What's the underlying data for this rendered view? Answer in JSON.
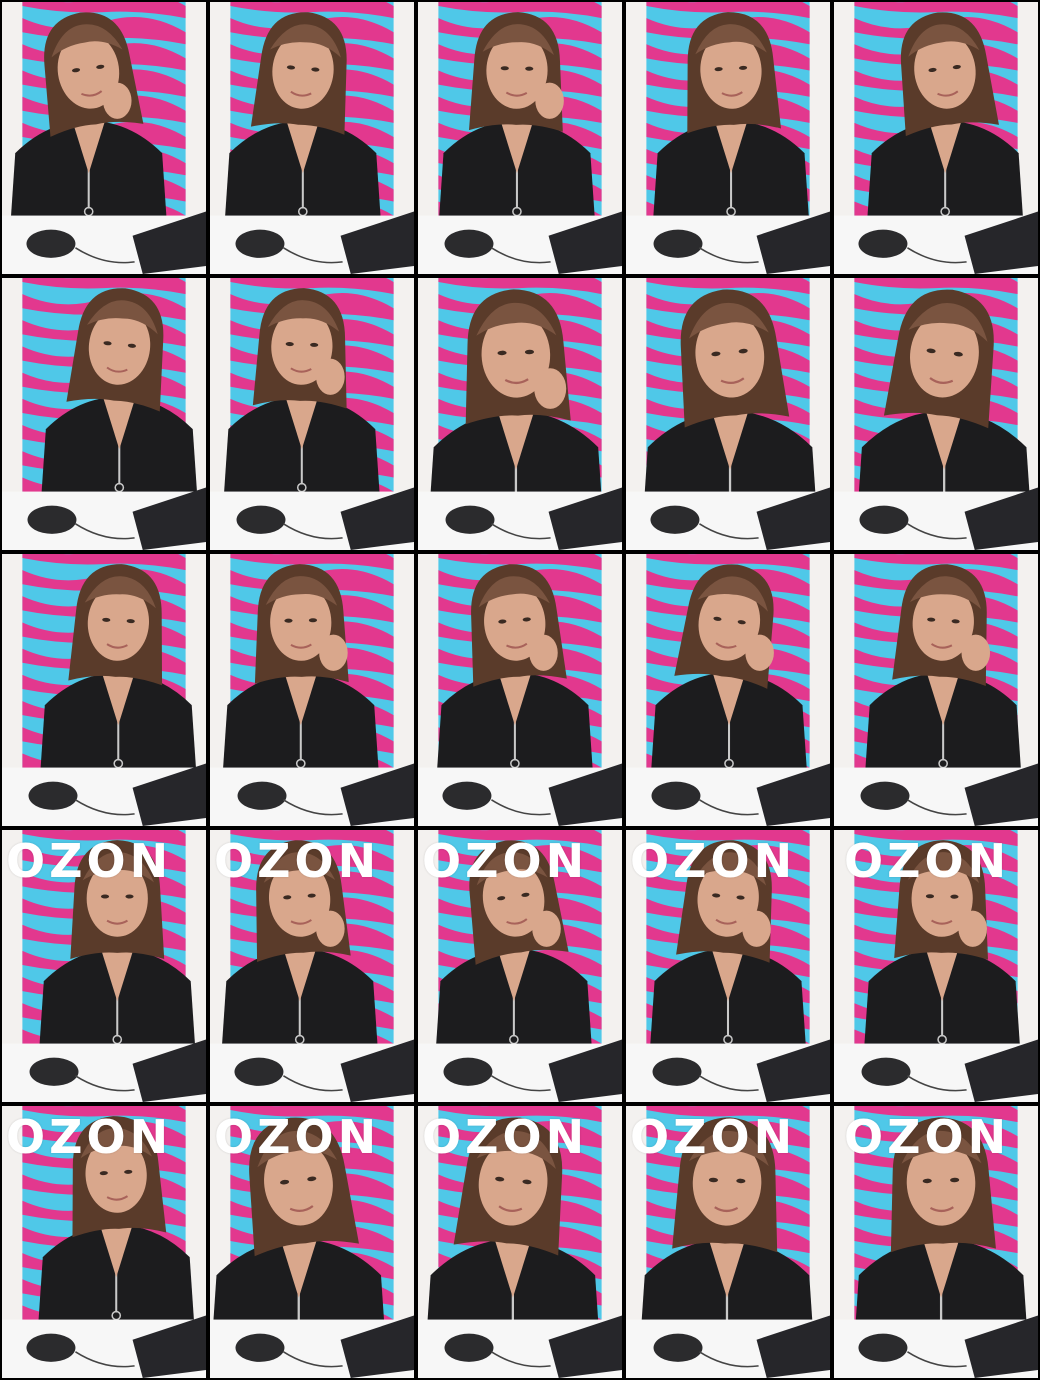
{
  "page": {
    "type": "photo-contact-sheet",
    "columns": 5,
    "rows": 5
  },
  "scene": {
    "brand_text": "OZON",
    "colors": {
      "wall": "#f3f1ef",
      "banner_pink": "#e2388e",
      "banner_blue": "#4fc8e8",
      "hair": "#5a3b2a",
      "hair_light": "#7a5440",
      "skin": "#d9a78c",
      "top": "#1c1c1e",
      "zipper": "#c9c9c9",
      "desk": "#f7f7f7",
      "mouse": "#2b2b2d",
      "laptop": "#26262a"
    }
  },
  "frames": [
    {
      "id": "frame-1",
      "brand_visible": false
    },
    {
      "id": "frame-2",
      "brand_visible": false
    },
    {
      "id": "frame-3",
      "brand_visible": false
    },
    {
      "id": "frame-4",
      "brand_visible": false
    },
    {
      "id": "frame-5",
      "brand_visible": false
    },
    {
      "id": "frame-6",
      "brand_visible": false
    },
    {
      "id": "frame-7",
      "brand_visible": false
    },
    {
      "id": "frame-8",
      "brand_visible": false
    },
    {
      "id": "frame-9",
      "brand_visible": false
    },
    {
      "id": "frame-10",
      "brand_visible": false
    },
    {
      "id": "frame-11",
      "brand_visible": false
    },
    {
      "id": "frame-12",
      "brand_visible": false
    },
    {
      "id": "frame-13",
      "brand_visible": false
    },
    {
      "id": "frame-14",
      "brand_visible": false
    },
    {
      "id": "frame-15",
      "brand_visible": false
    },
    {
      "id": "frame-16",
      "brand_visible": true
    },
    {
      "id": "frame-17",
      "brand_visible": true
    },
    {
      "id": "frame-18",
      "brand_visible": true
    },
    {
      "id": "frame-19",
      "brand_visible": true
    },
    {
      "id": "frame-20",
      "brand_visible": true
    },
    {
      "id": "frame-21",
      "brand_visible": true
    },
    {
      "id": "frame-22",
      "brand_visible": true
    },
    {
      "id": "frame-23",
      "brand_visible": true
    },
    {
      "id": "frame-24",
      "brand_visible": true
    },
    {
      "id": "frame-25",
      "brand_visible": true
    }
  ]
}
